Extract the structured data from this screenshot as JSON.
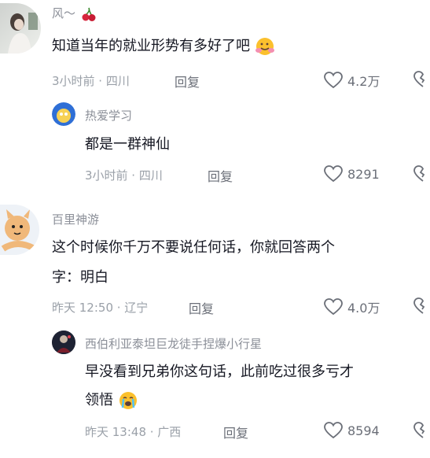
{
  "comments": [
    {
      "name": "风～",
      "text": "知道当年的就业形势有多好了吧",
      "time": "3小时前 · 四川",
      "reply": "回复",
      "likes": "4.2万"
    },
    {
      "name": "热爱学习",
      "text": "都是一群神仙",
      "time": "3小时前 · 四川",
      "reply": "回复",
      "likes": "8291"
    },
    {
      "name": "百里神游",
      "text_line1": "这个时候你千万不要说任何话，你就回答两个",
      "text_line2": "字：明白",
      "time": "昨天 12:50 · 辽宁",
      "reply": "回复",
      "likes": "4.0万"
    },
    {
      "name": "西伯利亚泰坦巨龙徒手捏爆小行星",
      "text_line1": "早没看到兄弟你这句话，此前吃过很多亏才",
      "text_line2": "领悟",
      "time": "昨天 13:48 · 广西",
      "reply": "回复",
      "likes": "8594"
    }
  ],
  "icons": {
    "like": "heart-outline-icon",
    "dislike": "broken-heart-icon",
    "cherry": "cherry-emoji",
    "hug": "hug-emoji",
    "cry": "crying-emoji"
  },
  "colors": {
    "name": "#8b8f98",
    "text": "#161823",
    "meta": "#9aa0a8"
  }
}
